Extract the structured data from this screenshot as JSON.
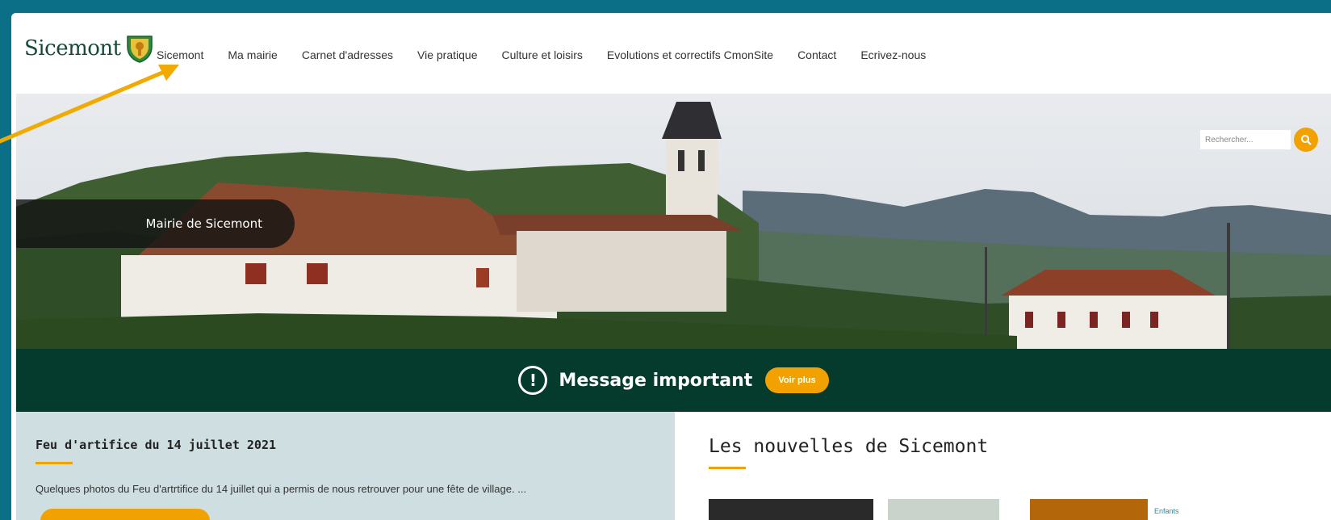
{
  "site": {
    "logo_text": "Sicemont"
  },
  "nav": {
    "items": [
      {
        "label": "Sicemont"
      },
      {
        "label": "Ma mairie"
      },
      {
        "label": "Carnet d'adresses"
      },
      {
        "label": "Vie pratique"
      },
      {
        "label": "Culture et loisirs"
      },
      {
        "label": "Evolutions et correctifs CmonSite"
      },
      {
        "label": "Contact"
      },
      {
        "label": "Ecrivez-nous"
      }
    ]
  },
  "search": {
    "placeholder": "Rechercher..."
  },
  "hero": {
    "caption": "Mairie de Sicemont"
  },
  "message": {
    "icon_glyph": "!",
    "title": "Message important",
    "button_label": "Voir plus"
  },
  "article": {
    "title": "Feu d'artifice du 14 juillet 2021",
    "excerpt": "Quelques photos du Feu d'artrtifice du 14 juillet qui a permis de nous retrouver pour une fête de village. ..."
  },
  "news": {
    "title": "Les nouvelles de Sicemont",
    "thumb_tag": "Enfants"
  },
  "colors": {
    "frame": "#0b6f87",
    "accent": "#f2a200",
    "dark_green": "#043b2d",
    "panel": "#cfdee1",
    "annotation_arrow": "#f2a900"
  },
  "icons": {
    "logo": "shield-icon",
    "search": "search-icon",
    "message": "exclamation-circle-icon",
    "annotation": "arrow-icon"
  }
}
